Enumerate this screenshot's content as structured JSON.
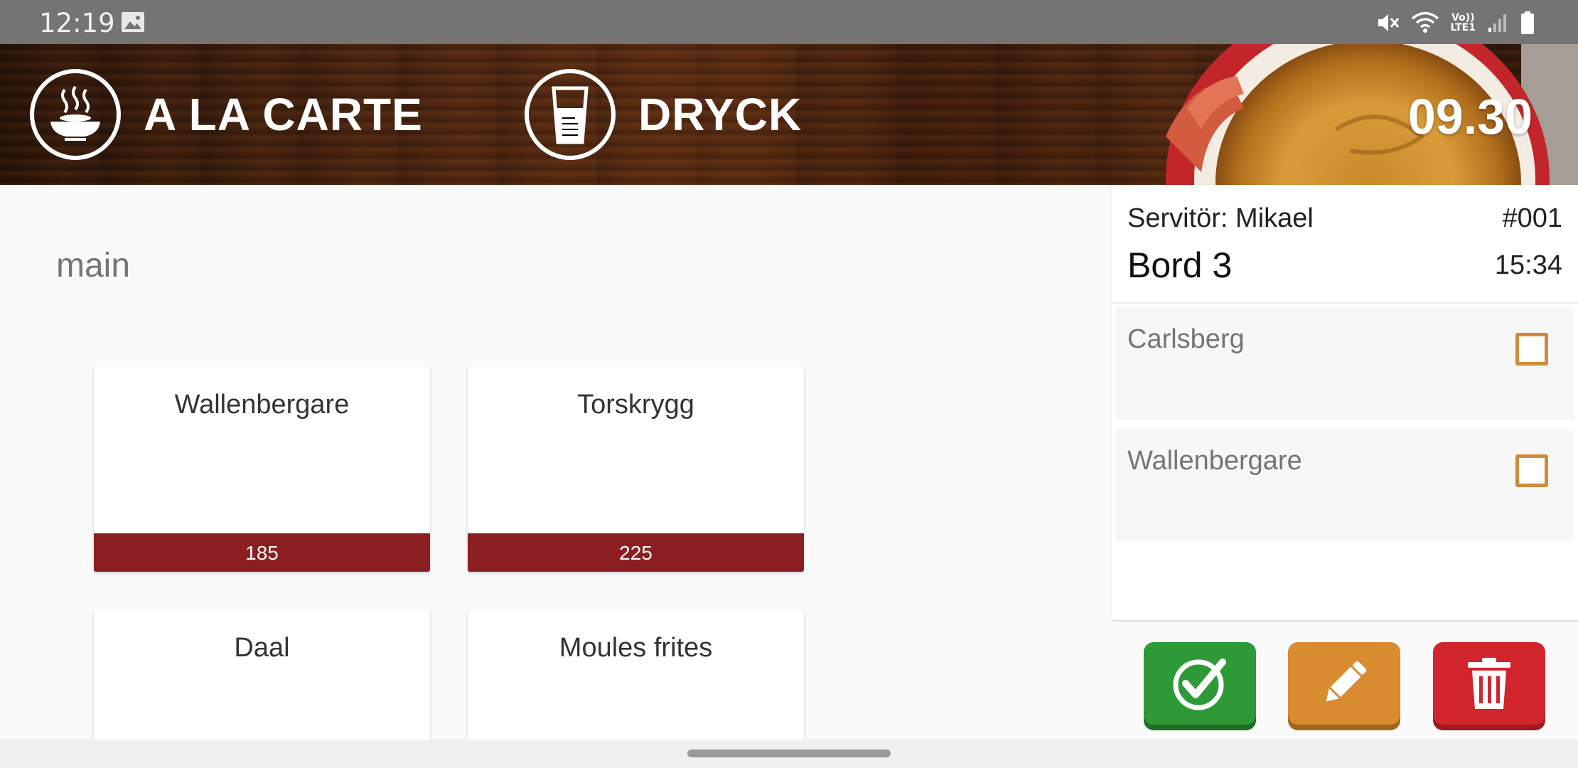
{
  "status_bar": {
    "time": "12:19",
    "lte_top": "Vo))",
    "lte_bottom": "LTE1"
  },
  "header": {
    "nav": [
      {
        "label": "A LA CARTE",
        "icon": "steaming-bowl-icon"
      },
      {
        "label": "DRYCK",
        "icon": "glass-icon"
      }
    ],
    "clock": "09.30"
  },
  "main": {
    "section_title": "main",
    "items": [
      {
        "name": "Wallenbergare",
        "price": "185"
      },
      {
        "name": "Torskrygg",
        "price": "225"
      },
      {
        "name": "Daal",
        "price": ""
      },
      {
        "name": "Moules frites",
        "price": ""
      }
    ]
  },
  "order": {
    "servitor": "Servitör: Mikael",
    "order_no": "#001",
    "table": "Bord 3",
    "time": "15:34",
    "lines": [
      {
        "name": "Carlsberg",
        "checked": false
      },
      {
        "name": "Wallenbergare",
        "checked": false
      }
    ]
  },
  "actions": {
    "confirm_icon": "check-circle-icon",
    "edit_icon": "pencil-icon",
    "delete_icon": "trash-icon"
  },
  "colors": {
    "price_bar": "#8b1e20",
    "confirm": "#2e9a37",
    "edit": "#d88b2f",
    "delete": "#d1252e",
    "checkbox": "#d08a3a"
  }
}
